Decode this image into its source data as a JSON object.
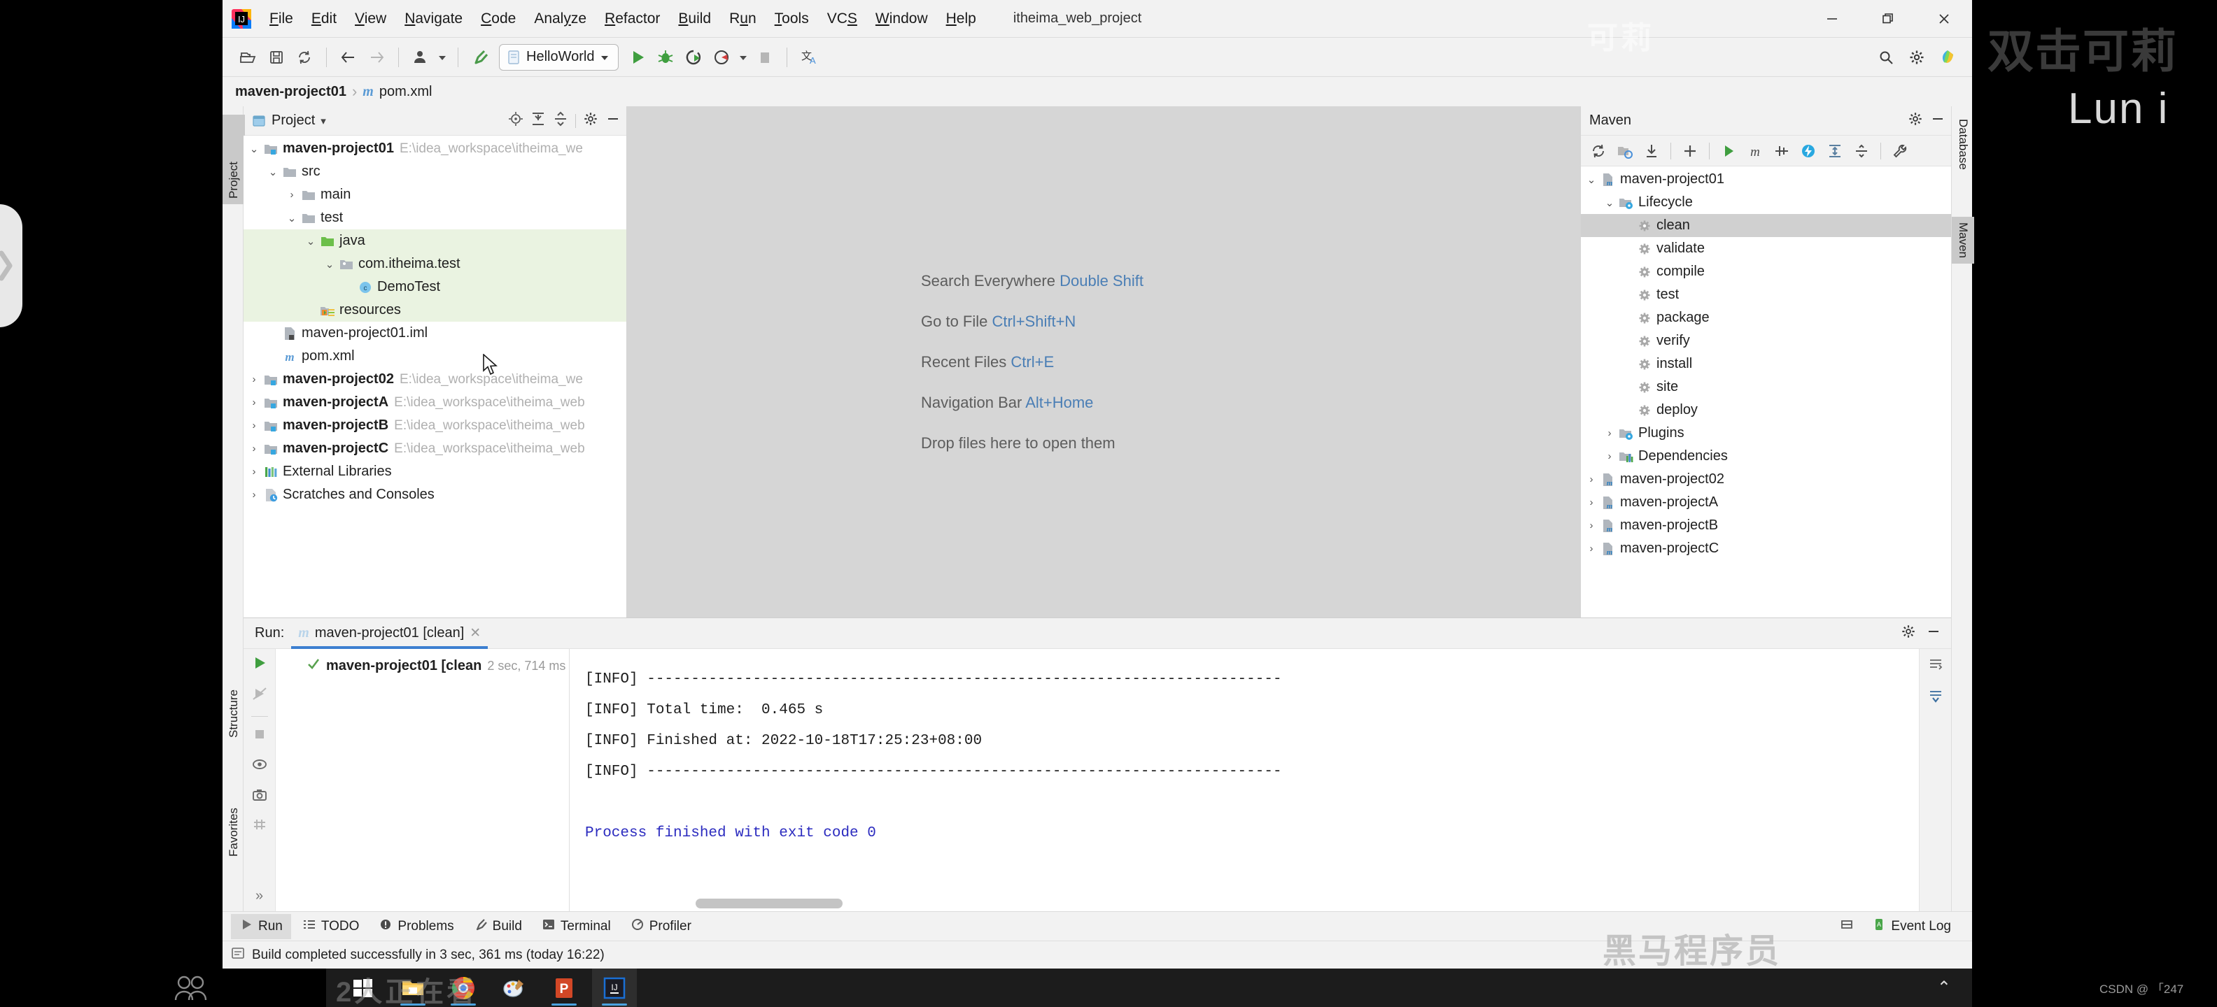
{
  "app": {
    "logo_name": "intellij-idea-logo",
    "project_name": "itheima_web_project",
    "window_minimize": "—",
    "window_restore": "❐",
    "window_close": "✕"
  },
  "menubar": {
    "items": [
      {
        "label": "File",
        "mnemonic": "F"
      },
      {
        "label": "Edit",
        "mnemonic": "E"
      },
      {
        "label": "View",
        "mnemonic": "V"
      },
      {
        "label": "Navigate",
        "mnemonic": "N"
      },
      {
        "label": "Code",
        "mnemonic": "C"
      },
      {
        "label": "Analyze",
        "mnemonic": "y"
      },
      {
        "label": "Refactor",
        "mnemonic": "R"
      },
      {
        "label": "Build",
        "mnemonic": "B"
      },
      {
        "label": "Run",
        "mnemonic": "u"
      },
      {
        "label": "Tools",
        "mnemonic": "T"
      },
      {
        "label": "VCS",
        "mnemonic": "S"
      },
      {
        "label": "Window",
        "mnemonic": "W"
      },
      {
        "label": "Help",
        "mnemonic": "H"
      }
    ]
  },
  "toolbar": {
    "open_label": "open-folder-icon",
    "save_label": "save-all-icon",
    "sync_label": "sync-icon",
    "back_label": "back-arrow-icon",
    "forward_label": "forward-arrow-icon",
    "profile_label": "user-profile-icon",
    "build_label": "build-hammer-icon",
    "run_config_name": "HelloWorld",
    "run_label": "run-icon",
    "debug_label": "debug-icon",
    "coverage_label": "run-with-coverage-icon",
    "profile_run_label": "profile-icon",
    "stop_label": "stop-icon",
    "translate_label": "translate-icon",
    "search_label": "search-icon",
    "settings_label": "settings-gear-icon"
  },
  "breadcrumb": {
    "project": "maven-project01",
    "separator": "›",
    "file": "pom.xml",
    "file_icon": "m"
  },
  "left_rail": {
    "project_tab": "Project"
  },
  "right_rail": {
    "database_tab": "Database",
    "maven_tab": "Maven"
  },
  "bottom_left_rail": {
    "structure_tab": "Structure",
    "favorites_tab": "Favorites"
  },
  "project_panel": {
    "title": "Project",
    "dropdown": "▾",
    "actions": [
      "locate-icon",
      "expand-all-icon",
      "collapse-all-icon",
      "settings-gear-icon",
      "hide-icon"
    ],
    "tree": [
      {
        "depth": 0,
        "twist": "⌄",
        "icon": "module-folder-icon",
        "label": "maven-project01",
        "bold": true,
        "path": "E:\\idea_workspace\\itheima_we",
        "highlight": false
      },
      {
        "depth": 1,
        "twist": "⌄",
        "icon": "folder-icon",
        "label": "src",
        "bold": false,
        "path": "",
        "highlight": false
      },
      {
        "depth": 2,
        "twist": "›",
        "icon": "folder-icon",
        "label": "main",
        "bold": false,
        "path": "",
        "highlight": false
      },
      {
        "depth": 2,
        "twist": "⌄",
        "icon": "folder-icon",
        "label": "test",
        "bold": false,
        "path": "",
        "highlight": false
      },
      {
        "depth": 3,
        "twist": "⌄",
        "icon": "source-folder-green-icon",
        "label": "java",
        "bold": false,
        "path": "",
        "highlight": true
      },
      {
        "depth": 4,
        "twist": "⌄",
        "icon": "package-icon",
        "label": "com.itheima.test",
        "bold": false,
        "path": "",
        "highlight": true
      },
      {
        "depth": 5,
        "twist": "",
        "icon": "class-icon",
        "label": "DemoTest",
        "bold": false,
        "path": "",
        "highlight": true
      },
      {
        "depth": 3,
        "twist": "",
        "icon": "resources-folder-icon",
        "label": "resources",
        "bold": false,
        "path": "",
        "highlight": true
      },
      {
        "depth": 1,
        "twist": "",
        "icon": "iml-file-icon",
        "label": "maven-project01.iml",
        "bold": false,
        "path": "",
        "highlight": false
      },
      {
        "depth": 1,
        "twist": "",
        "icon": "maven-pom-icon",
        "label": "pom.xml",
        "bold": false,
        "path": "",
        "highlight": false
      },
      {
        "depth": 0,
        "twist": "›",
        "icon": "module-folder-icon",
        "label": "maven-project02",
        "bold": true,
        "path": "E:\\idea_workspace\\itheima_we",
        "highlight": false
      },
      {
        "depth": 0,
        "twist": "›",
        "icon": "module-folder-icon",
        "label": "maven-projectA",
        "bold": true,
        "path": "E:\\idea_workspace\\itheima_web",
        "highlight": false
      },
      {
        "depth": 0,
        "twist": "›",
        "icon": "module-folder-icon",
        "label": "maven-projectB",
        "bold": true,
        "path": "E:\\idea_workspace\\itheima_web",
        "highlight": false
      },
      {
        "depth": 0,
        "twist": "›",
        "icon": "module-folder-icon",
        "label": "maven-projectC",
        "bold": true,
        "path": "E:\\idea_workspace\\itheima_web",
        "highlight": false
      },
      {
        "depth": 0,
        "twist": "›",
        "icon": "external-libraries-icon",
        "label": "External Libraries",
        "bold": false,
        "path": "",
        "highlight": false
      },
      {
        "depth": 0,
        "twist": "›",
        "icon": "scratches-icon",
        "label": "Scratches and Consoles",
        "bold": false,
        "path": "",
        "highlight": false
      }
    ]
  },
  "editor": {
    "hints": [
      {
        "action": "Search Everywhere",
        "shortcut": "Double Shift"
      },
      {
        "action": "Go to File",
        "shortcut": "Ctrl+Shift+N"
      },
      {
        "action": "Recent Files",
        "shortcut": "Ctrl+E"
      },
      {
        "action": "Navigation Bar",
        "shortcut": "Alt+Home"
      },
      {
        "action": "Drop files here to open them",
        "shortcut": ""
      }
    ]
  },
  "maven_panel": {
    "title": "Maven",
    "actions": [
      "settings-gear-icon",
      "hide-icon"
    ],
    "toolbar": [
      "reload-icon",
      "add-maven-project-icon",
      "download-sources-icon",
      "plus-icon",
      "execute-goal-icon",
      "maven-m-icon",
      "toggle-skip-tests-icon",
      "toggle-offline-icon",
      "expand-all-icon",
      "collapse-all-icon",
      "wrench-icon"
    ],
    "tree": [
      {
        "depth": 0,
        "twist": "⌄",
        "icon": "maven-project-icon",
        "label": "maven-project01",
        "selected": false
      },
      {
        "depth": 1,
        "twist": "⌄",
        "icon": "lifecycle-folder-icon",
        "label": "Lifecycle",
        "selected": false
      },
      {
        "depth": 2,
        "twist": "",
        "icon": "goal-gear-icon",
        "label": "clean",
        "selected": true
      },
      {
        "depth": 2,
        "twist": "",
        "icon": "goal-gear-icon",
        "label": "validate",
        "selected": false
      },
      {
        "depth": 2,
        "twist": "",
        "icon": "goal-gear-icon",
        "label": "compile",
        "selected": false
      },
      {
        "depth": 2,
        "twist": "",
        "icon": "goal-gear-icon",
        "label": "test",
        "selected": false
      },
      {
        "depth": 2,
        "twist": "",
        "icon": "goal-gear-icon",
        "label": "package",
        "selected": false
      },
      {
        "depth": 2,
        "twist": "",
        "icon": "goal-gear-icon",
        "label": "verify",
        "selected": false
      },
      {
        "depth": 2,
        "twist": "",
        "icon": "goal-gear-icon",
        "label": "install",
        "selected": false
      },
      {
        "depth": 2,
        "twist": "",
        "icon": "goal-gear-icon",
        "label": "site",
        "selected": false
      },
      {
        "depth": 2,
        "twist": "",
        "icon": "goal-gear-icon",
        "label": "deploy",
        "selected": false
      },
      {
        "depth": 1,
        "twist": "›",
        "icon": "plugins-folder-icon",
        "label": "Plugins",
        "selected": false
      },
      {
        "depth": 1,
        "twist": "›",
        "icon": "dependencies-folder-icon",
        "label": "Dependencies",
        "selected": false
      },
      {
        "depth": 0,
        "twist": "›",
        "icon": "maven-project-icon",
        "label": "maven-project02",
        "selected": false
      },
      {
        "depth": 0,
        "twist": "›",
        "icon": "maven-project-icon",
        "label": "maven-projectA",
        "selected": false
      },
      {
        "depth": 0,
        "twist": "›",
        "icon": "maven-project-icon",
        "label": "maven-projectB",
        "selected": false
      },
      {
        "depth": 0,
        "twist": "›",
        "icon": "maven-project-icon",
        "label": "maven-projectC",
        "selected": false
      }
    ]
  },
  "run_panel": {
    "label": "Run:",
    "tab_label": "maven-project01 [clean]",
    "tab_icon": "maven-m-icon",
    "tab_close": "✕",
    "actions": [
      "settings-gear-icon",
      "hide-icon"
    ],
    "gutter_icons": [
      "rerun-icon",
      "rerun-failed-icon",
      "stop-icon",
      "eye-toggle-icon",
      "export-icon",
      "filter-icon",
      "more-icon"
    ],
    "tree_row": {
      "status_icon": "success-check-icon",
      "label": "maven-project01 [clean",
      "duration": "2 sec, 714 ms"
    },
    "console_lines": [
      {
        "text": "[INFO] ------------------------------------------------------------------------",
        "color": "black"
      },
      {
        "text": "[INFO] Total time:  0.465 s",
        "color": "black"
      },
      {
        "text": "[INFO] Finished at: 2022-10-18T17:25:23+08:00",
        "color": "black"
      },
      {
        "text": "[INFO] ------------------------------------------------------------------------",
        "color": "black"
      },
      {
        "text": "",
        "color": "black"
      },
      {
        "text": "Process finished with exit code 0",
        "color": "blue"
      }
    ],
    "console_rail_icons": [
      "soft-wrap-icon",
      "scroll-to-end-icon"
    ]
  },
  "toolwindow_bar": {
    "items": [
      {
        "label": "Run",
        "icon": "run-triangle-icon",
        "active": true
      },
      {
        "label": "TODO",
        "icon": "todo-list-icon",
        "active": false
      },
      {
        "label": "Problems",
        "icon": "problems-icon",
        "active": false
      },
      {
        "label": "Build",
        "icon": "build-hammer-icon",
        "active": false
      },
      {
        "label": "Terminal",
        "icon": "terminal-icon",
        "active": false
      },
      {
        "label": "Profiler",
        "icon": "profiler-icon",
        "active": false
      }
    ],
    "event_log": {
      "label": "Event Log",
      "icon": "event-log-icon"
    },
    "right_icons": [
      "layout-icon"
    ]
  },
  "statusbar": {
    "icon": "build-status-icon",
    "message": "Build completed successfully in 3 sec, 361 ms (today 16:22)"
  },
  "taskbar": {
    "items": [
      {
        "name": "start-windows-icon",
        "active": false,
        "running": false
      },
      {
        "name": "file-explorer-icon",
        "active": false,
        "running": true
      },
      {
        "name": "google-chrome-icon",
        "active": false,
        "running": true
      },
      {
        "name": "paint-icon",
        "active": false,
        "running": false
      },
      {
        "name": "powerpoint-icon",
        "active": false,
        "running": true
      },
      {
        "name": "intellij-idea-icon",
        "active": true,
        "running": true
      }
    ],
    "tray_expand": "⌃"
  },
  "overlays": {
    "player_chevron": "›",
    "watermark_keli": "可莉",
    "watermark_shuangji": "双击可莉",
    "watermark_luni": "Lun i",
    "watermark_heima": "黑马程序员",
    "watermark_zhengzaikan": "2人正在看",
    "watermark_csdn": "CSDN @ 「247"
  },
  "colors": {
    "accent_blue": "#3c7fd0",
    "highlight_green": "#eaf3e1",
    "selection_gray": "#d0d0d0",
    "link_blue": "#4a7eb5",
    "console_blue": "#2b2bbf",
    "panel_bg": "#f2f2f2",
    "editor_bg": "#d6d6d6"
  }
}
